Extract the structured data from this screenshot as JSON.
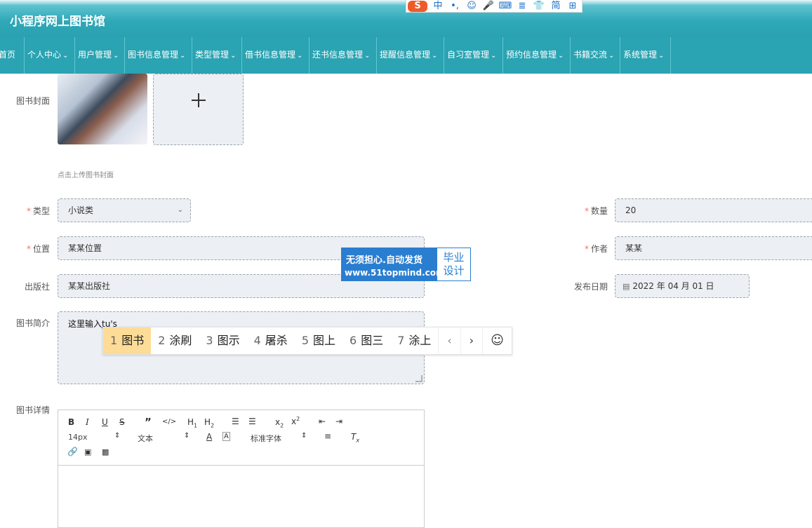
{
  "app": {
    "title": "小程序网上图书馆"
  },
  "ime_bar": {
    "items": [
      "S",
      "中",
      "•,",
      "☺",
      "🎤",
      "⌨",
      "≣",
      "👕",
      "简",
      "⊞"
    ]
  },
  "nav": {
    "items": [
      {
        "label": "首页"
      },
      {
        "label": "个人中心"
      },
      {
        "label": "用户管理"
      },
      {
        "label": "图书信息管理"
      },
      {
        "label": "类型管理"
      },
      {
        "label": "借书信息管理"
      },
      {
        "label": "还书信息管理"
      },
      {
        "label": "提醒信息管理"
      },
      {
        "label": "自习室管理"
      },
      {
        "label": "预约信息管理"
      },
      {
        "label": "书籍交流"
      },
      {
        "label": "系统管理"
      }
    ]
  },
  "form": {
    "cover_label": "图书封面",
    "cover_hint": "点击上传图书封面",
    "type_label": "类型",
    "type_value": "小说类",
    "quantity_label": "数量",
    "quantity_value": "20",
    "location_label": "位置",
    "location_value": "某某位置",
    "author_label": "作者",
    "author_value": "某某",
    "publisher_label": "出版社",
    "publisher_value": "某某出版社",
    "date_label": "发布日期",
    "date_value": "2022 年 04 月 01 日",
    "intro_label": "图书简介",
    "intro_value": "这里输入",
    "intro_pinyin": "tu's",
    "detail_label": "图书详情"
  },
  "watermark": {
    "line1": "无须担心.自动发货",
    "line2": "www.51topmind.com",
    "right1": "毕业",
    "right2": "设计"
  },
  "ime_candidates": [
    {
      "num": "1",
      "text": "图书"
    },
    {
      "num": "2",
      "text": "涂刷"
    },
    {
      "num": "3",
      "text": "图示"
    },
    {
      "num": "4",
      "text": "屠杀"
    },
    {
      "num": "5",
      "text": "图上"
    },
    {
      "num": "6",
      "text": "图三"
    },
    {
      "num": "7",
      "text": "涂上"
    }
  ],
  "editor": {
    "font_size": "14px",
    "text_style": "文本",
    "font_family": "标准字体"
  }
}
